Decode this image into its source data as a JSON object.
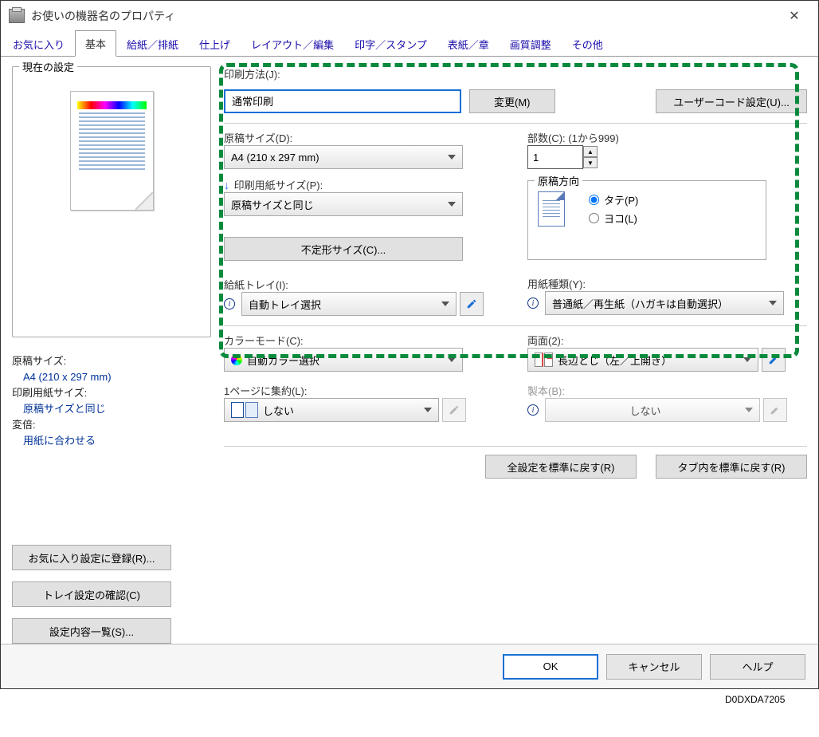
{
  "window": {
    "title": "お使いの機器名のプロパティ"
  },
  "tabs": {
    "favorites": "お気に入り",
    "basic": "基本",
    "paper": "給紙／排紙",
    "finish": "仕上げ",
    "layout": "レイアウト／編集",
    "stamp": "印字／スタンプ",
    "cover": "表紙／章",
    "quality": "画質調整",
    "other": "その他"
  },
  "left": {
    "group_title": "現在の設定",
    "summary": {
      "doc_size_label": "原稿サイズ:",
      "doc_size_value": "A4 (210 x 297 mm)",
      "print_size_label": "印刷用紙サイズ:",
      "print_size_value": "原稿サイズと同じ",
      "zoom_label": "変倍:",
      "zoom_value": "用紙に合わせる"
    },
    "buttons": {
      "register": "お気に入り設定に登録(R)...",
      "tray": "トレイ設定の確認(C)",
      "list": "設定内容一覧(S)..."
    }
  },
  "right": {
    "job": {
      "label": "印刷方法(J):",
      "value": "通常印刷",
      "change_btn": "変更(M)",
      "usercode_btn": "ユーザーコード設定(U)..."
    },
    "doc_size": {
      "label": "原稿サイズ(D):",
      "value": "A4 (210 x 297 mm)"
    },
    "print_size": {
      "label": "印刷用紙サイズ(P):",
      "value": "原稿サイズと同じ"
    },
    "custom_size_btn": "不定形サイズ(C)...",
    "copies": {
      "label": "部数(C): (1から999)",
      "value": "1"
    },
    "orientation": {
      "group": "原稿方向",
      "portrait": "タテ(P)",
      "landscape": "ヨコ(L)"
    },
    "tray": {
      "label": "給紙トレイ(I):",
      "value": "自動トレイ選択"
    },
    "paper_type": {
      "label": "用紙種類(Y):",
      "value": "普通紙／再生紙（ハガキは自動選択）"
    },
    "color": {
      "label": "カラーモード(C):",
      "value": "自動カラー選択"
    },
    "duplex": {
      "label": "両面(2):",
      "value": "長辺とじ（左／上開き）"
    },
    "nup": {
      "label": "1ページに集約(L):",
      "value": "しない"
    },
    "booklet": {
      "label": "製本(B):",
      "value": "しない"
    },
    "reset_all": "全設定を標準に戻す(R)",
    "reset_tab": "タブ内を標準に戻す(R)"
  },
  "footer": {
    "ok": "OK",
    "cancel": "キャンセル",
    "help": "ヘルプ"
  },
  "image_tag": "D0DXDA7205"
}
